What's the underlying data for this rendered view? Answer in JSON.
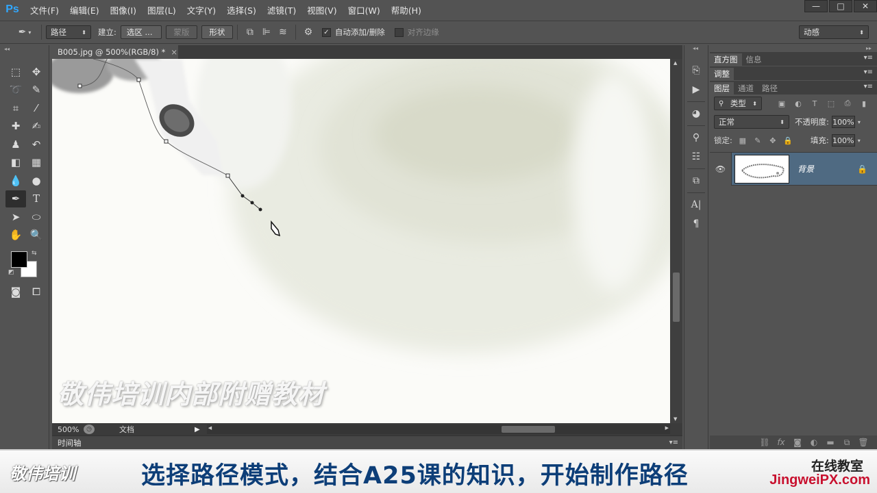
{
  "app": {
    "logo": "Ps"
  },
  "menu": [
    "文件(F)",
    "编辑(E)",
    "图像(I)",
    "图层(L)",
    "文字(Y)",
    "选择(S)",
    "滤镜(T)",
    "视图(V)",
    "窗口(W)",
    "帮助(H)"
  ],
  "window_controls": {
    "minimize": "—",
    "restore": "□",
    "close": "✕"
  },
  "options": {
    "mode_select": "路径",
    "make_label": "建立:",
    "selection_button": "选区 ...",
    "mask_button": "蒙版",
    "shape_button": "形状",
    "auto_add_delete": "自动添加/删除",
    "align_edges": "对齐边缘",
    "workspace": "动感"
  },
  "document": {
    "tab_title": "B005.jpg @ 500%(RGB/8) *",
    "close": "×",
    "zoom": "500%",
    "status": "文档",
    "timeline_label": "时间轴"
  },
  "watermark": "敬伟培训内部附赠教材",
  "panels": {
    "top_tabs": [
      "直方图",
      "信息"
    ],
    "adjust_tab": "调整",
    "layer_tabs": [
      "图层",
      "通道",
      "路径"
    ],
    "filter_kind": "类型",
    "blend_mode": "正常",
    "opacity_label": "不透明度:",
    "opacity_value": "100%",
    "lock_label": "锁定:",
    "fill_label": "填充:",
    "fill_value": "100%",
    "layer_name": "背景"
  },
  "caption": {
    "brand_left": "敬伟培训",
    "subtitle": "选择路径模式，结合A25课的知识，开始制作路径",
    "brand_right_top": "在线教室",
    "brand_right_bottom": "JingweiPX.com"
  },
  "colors": {
    "foreground": "#000000",
    "background": "#ffffff",
    "selected_layer": "#4f6a82",
    "caption_text": "#0d3e78"
  }
}
